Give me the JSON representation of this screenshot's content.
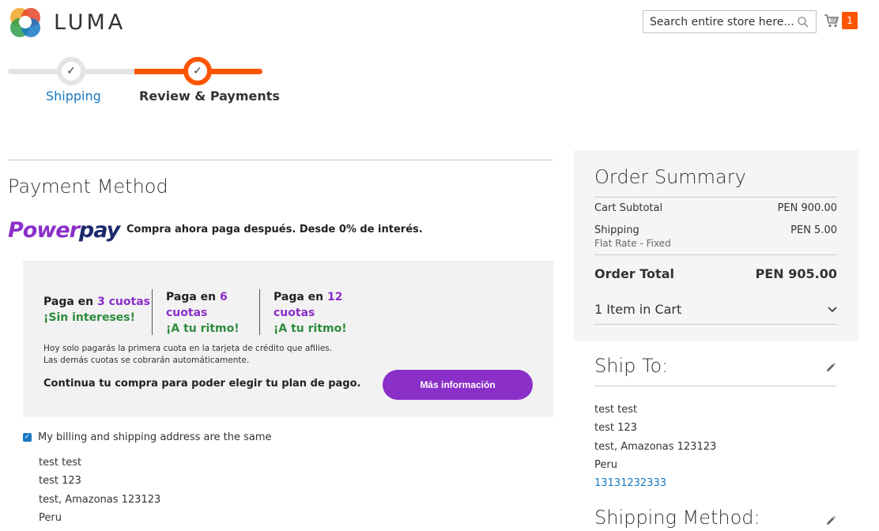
{
  "header": {
    "logo_text": "LUMA",
    "search_placeholder": "Search entire store here...",
    "cart_count": "1"
  },
  "progress": {
    "steps": [
      {
        "label": "Shipping",
        "state": "complete"
      },
      {
        "label": "Review & Payments",
        "state": "active"
      }
    ]
  },
  "payment": {
    "title": "Payment Method",
    "powerpay": {
      "logo_part1": "Power",
      "logo_part2": "pay",
      "tagline": "Compra ahora paga después. Desde 0% de interés.",
      "plans": [
        {
          "prefix": "Paga en ",
          "number": "3 cuotas",
          "suffix": "¡Sin intereses!"
        },
        {
          "prefix": "Paga en ",
          "number": "6",
          "line2": "cuotas",
          "suffix": "¡A tu ritmo!"
        },
        {
          "prefix": "Paga en ",
          "number": "12",
          "line2": "cuotas",
          "suffix": "¡A tu ritmo!"
        }
      ],
      "note_line1": "Hoy solo pagarás la primera cuota en la tarjeta de crédito que afilies.",
      "note_line2": "Las demás cuotas se cobrarán automáticamente.",
      "cta_text": "Continua tu compra para poder elegir tu plan de pago.",
      "button_label": "Más información"
    },
    "billing_same_label": "My billing and shipping address are the same",
    "billing_same_checked": true,
    "billing_address": [
      "test test",
      "test 123",
      "test, Amazonas 123123",
      "Peru"
    ]
  },
  "summary": {
    "title": "Order Summary",
    "subtotal_label": "Cart Subtotal",
    "subtotal_value": "PEN 900.00",
    "shipping_label": "Shipping",
    "shipping_value": "PEN 5.00",
    "shipping_method": "Flat Rate - Fixed",
    "total_label": "Order Total",
    "total_value": "PEN 905.00",
    "items_label": "1 Item in Cart"
  },
  "ship_to": {
    "title": "Ship To:",
    "address": [
      "test test",
      "test 123",
      "test, Amazonas 123123",
      "Peru"
    ],
    "phone": "13131232333"
  },
  "shipping_method": {
    "title": "Shipping Method:"
  },
  "colors": {
    "accent_orange": "#ff5501",
    "link_blue": "#1979c3",
    "powerpay_purple": "#8b2fc9",
    "powerpay_navy": "#1c2a6b",
    "powerpay_green": "#2e8b3e"
  }
}
